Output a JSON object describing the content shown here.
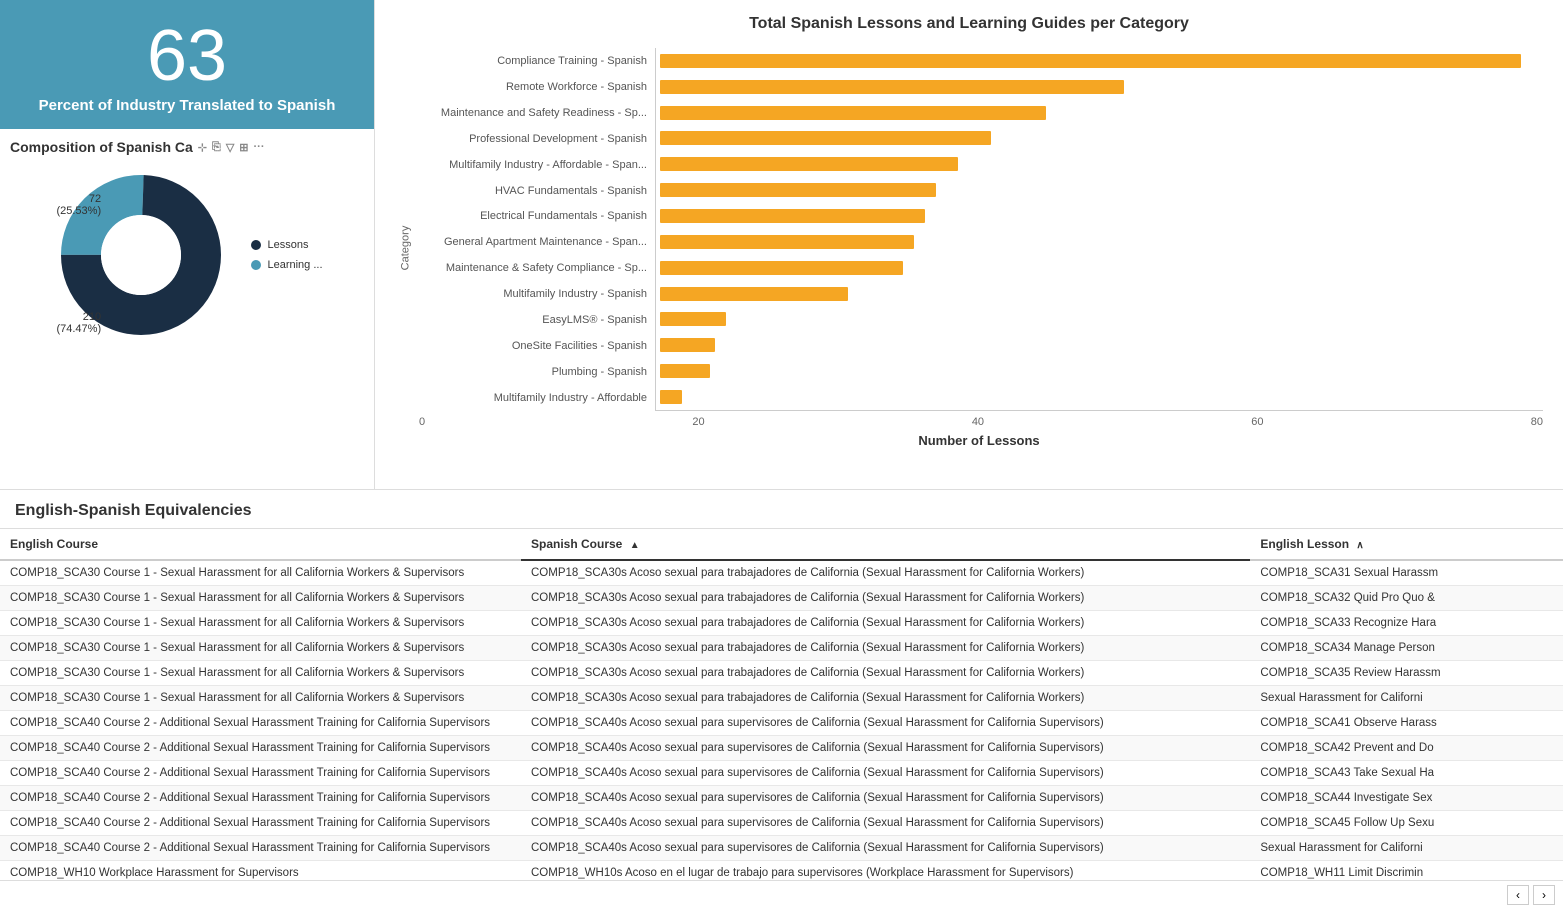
{
  "kpi": {
    "number": "63",
    "label": "Percent of Industry Translated to Spanish"
  },
  "composition": {
    "title": "Composition of Spanish Ca",
    "legend": [
      {
        "id": "lessons",
        "label": "Lessons",
        "color": "#1a2e44"
      },
      {
        "id": "learning",
        "label": "Learning ...",
        "color": "#4a9ab5"
      }
    ],
    "donut": {
      "segments": [
        {
          "label": "72\n(25.53%)",
          "value": 72,
          "percent": 25.53,
          "color": "#4a9ab5"
        },
        {
          "label": "210\n(74.47%)",
          "value": 210,
          "percent": 74.47,
          "color": "#1a2e44"
        }
      ]
    },
    "labelTopLeft": "72\n(25.53%)",
    "labelBottomLeft": "210\n(74.47%)"
  },
  "barChart": {
    "title": "Total Spanish Lessons and Learning Guides per Category",
    "yAxisLabel": "Category",
    "xAxisLabel": "Number of Lessons",
    "xTicks": [
      "0",
      "20",
      "40",
      "60",
      "80"
    ],
    "maxValue": 80,
    "categories": [
      {
        "label": "Compliance Training - Spanish",
        "value": 78
      },
      {
        "label": "Remote Workforce - Spanish",
        "value": 42
      },
      {
        "label": "Maintenance and Safety Readiness - Sp...",
        "value": 35
      },
      {
        "label": "Professional Development - Spanish",
        "value": 30
      },
      {
        "label": "Multifamily Industry - Affordable - Span...",
        "value": 27
      },
      {
        "label": "HVAC Fundamentals - Spanish",
        "value": 25
      },
      {
        "label": "Electrical Fundamentals - Spanish",
        "value": 24
      },
      {
        "label": "General Apartment Maintenance - Span...",
        "value": 23
      },
      {
        "label": "Maintenance & Safety Compliance - Sp...",
        "value": 22
      },
      {
        "label": "Multifamily Industry - Spanish",
        "value": 17
      },
      {
        "label": "EasyLMS® - Spanish",
        "value": 6
      },
      {
        "label": "OneSite Facilities - Spanish",
        "value": 5
      },
      {
        "label": "Plumbing - Spanish",
        "value": 4.5
      },
      {
        "label": "Multifamily Industry - Affordable",
        "value": 2
      }
    ]
  },
  "table": {
    "title": "English-Spanish Equivalencies",
    "columns": [
      {
        "id": "english",
        "label": "English Course",
        "sorted": false
      },
      {
        "id": "spanish",
        "label": "Spanish Course",
        "sorted": true
      },
      {
        "id": "lesson",
        "label": "English Lesson",
        "sorted": false
      }
    ],
    "rows": [
      {
        "english": "COMP18_SCA30 Course 1 - Sexual Harassment for all California Workers & Supervisors",
        "spanish": "COMP18_SCA30s Acoso sexual para trabajadores de California (Sexual Harassment for California Workers)",
        "lesson": "COMP18_SCA31 Sexual Harassm"
      },
      {
        "english": "COMP18_SCA30 Course 1 - Sexual Harassment for all California Workers & Supervisors",
        "spanish": "COMP18_SCA30s Acoso sexual para trabajadores de California (Sexual Harassment for California Workers)",
        "lesson": "COMP18_SCA32 Quid Pro Quo &"
      },
      {
        "english": "COMP18_SCA30 Course 1 - Sexual Harassment for all California Workers & Supervisors",
        "spanish": "COMP18_SCA30s Acoso sexual para trabajadores de California (Sexual Harassment for California Workers)",
        "lesson": "COMP18_SCA33 Recognize Hara"
      },
      {
        "english": "COMP18_SCA30 Course 1 - Sexual Harassment for all California Workers & Supervisors",
        "spanish": "COMP18_SCA30s Acoso sexual para trabajadores de California (Sexual Harassment for California Workers)",
        "lesson": "COMP18_SCA34 Manage Person"
      },
      {
        "english": "COMP18_SCA30 Course 1 - Sexual Harassment for all California Workers & Supervisors",
        "spanish": "COMP18_SCA30s Acoso sexual para trabajadores de California (Sexual Harassment for California Workers)",
        "lesson": "COMP18_SCA35 Review Harassm"
      },
      {
        "english": "COMP18_SCA30 Course 1 - Sexual Harassment for all California Workers & Supervisors",
        "spanish": "COMP18_SCA30s Acoso sexual para trabajadores de California (Sexual Harassment for California Workers)",
        "lesson": "Sexual Harassment for Californi"
      },
      {
        "english": "COMP18_SCA40 Course 2 - Additional Sexual Harassment Training for California Supervisors",
        "spanish": "COMP18_SCA40s Acoso sexual para supervisores de California (Sexual Harassment for California Supervisors)",
        "lesson": "COMP18_SCA41 Observe Harass"
      },
      {
        "english": "COMP18_SCA40 Course 2 - Additional Sexual Harassment Training for California Supervisors",
        "spanish": "COMP18_SCA40s Acoso sexual para supervisores de California (Sexual Harassment for California Supervisors)",
        "lesson": "COMP18_SCA42 Prevent and Do"
      },
      {
        "english": "COMP18_SCA40 Course 2 - Additional Sexual Harassment Training for California Supervisors",
        "spanish": "COMP18_SCA40s Acoso sexual para supervisores de California (Sexual Harassment for California Supervisors)",
        "lesson": "COMP18_SCA43 Take Sexual Ha"
      },
      {
        "english": "COMP18_SCA40 Course 2 - Additional Sexual Harassment Training for California Supervisors",
        "spanish": "COMP18_SCA40s Acoso sexual para supervisores de California (Sexual Harassment for California Supervisors)",
        "lesson": "COMP18_SCA44 Investigate Sex"
      },
      {
        "english": "COMP18_SCA40 Course 2 - Additional Sexual Harassment Training for California Supervisors",
        "spanish": "COMP18_SCA40s Acoso sexual para supervisores de California (Sexual Harassment for California Supervisors)",
        "lesson": "COMP18_SCA45 Follow Up Sexu"
      },
      {
        "english": "COMP18_SCA40 Course 2 - Additional Sexual Harassment Training for California Supervisors",
        "spanish": "COMP18_SCA40s Acoso sexual para supervisores de California (Sexual Harassment for California Supervisors)",
        "lesson": "Sexual Harassment for Californi"
      },
      {
        "english": "COMP18_WH10 Workplace Harassment for Supervisors",
        "spanish": "COMP18_WH10s Acoso en el lugar de trabajo para supervisores (Workplace Harassment for Supervisors)",
        "lesson": "COMP18_WH11 Limit Discrimin"
      }
    ]
  },
  "scrollNav": {
    "prevLabel": "‹",
    "nextLabel": "›"
  }
}
